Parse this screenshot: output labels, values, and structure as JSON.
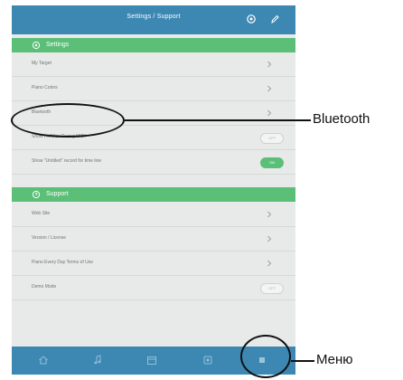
{
  "header": {
    "title": "Settings / Support"
  },
  "settings": {
    "title": "Settings",
    "rows": [
      {
        "label": "My Target"
      },
      {
        "label": "Piano Colors"
      },
      {
        "label": "Bluetooth"
      },
      {
        "label": "Show Hit/Miss During MIDI",
        "toggle": "OFF"
      },
      {
        "label": "Show \"Untitled\" record for time line",
        "toggle": "ON"
      }
    ]
  },
  "support": {
    "title": "Support",
    "rows": [
      {
        "label": "Web Site"
      },
      {
        "label": "Version / License"
      },
      {
        "label": "Piano Every Day Terms of Use"
      },
      {
        "label": "Demo Mode",
        "toggle": "OFF"
      }
    ]
  },
  "tabs": [
    "home",
    "music",
    "calendar",
    "record",
    "menu"
  ],
  "annotations": {
    "bluetooth": "Bluetooth",
    "menu": "Меню"
  },
  "colors": {
    "header": "#3d88b3",
    "section": "#5bbf78",
    "background": "#e8eaea"
  },
  "icons": {
    "header": [
      "settings-icon",
      "edit-icon"
    ],
    "sections": [
      "settings-icon",
      "support-icon"
    ],
    "tabs": [
      "home-icon",
      "music-note-icon",
      "calendar-icon",
      "record-icon",
      "menu-icon"
    ]
  }
}
